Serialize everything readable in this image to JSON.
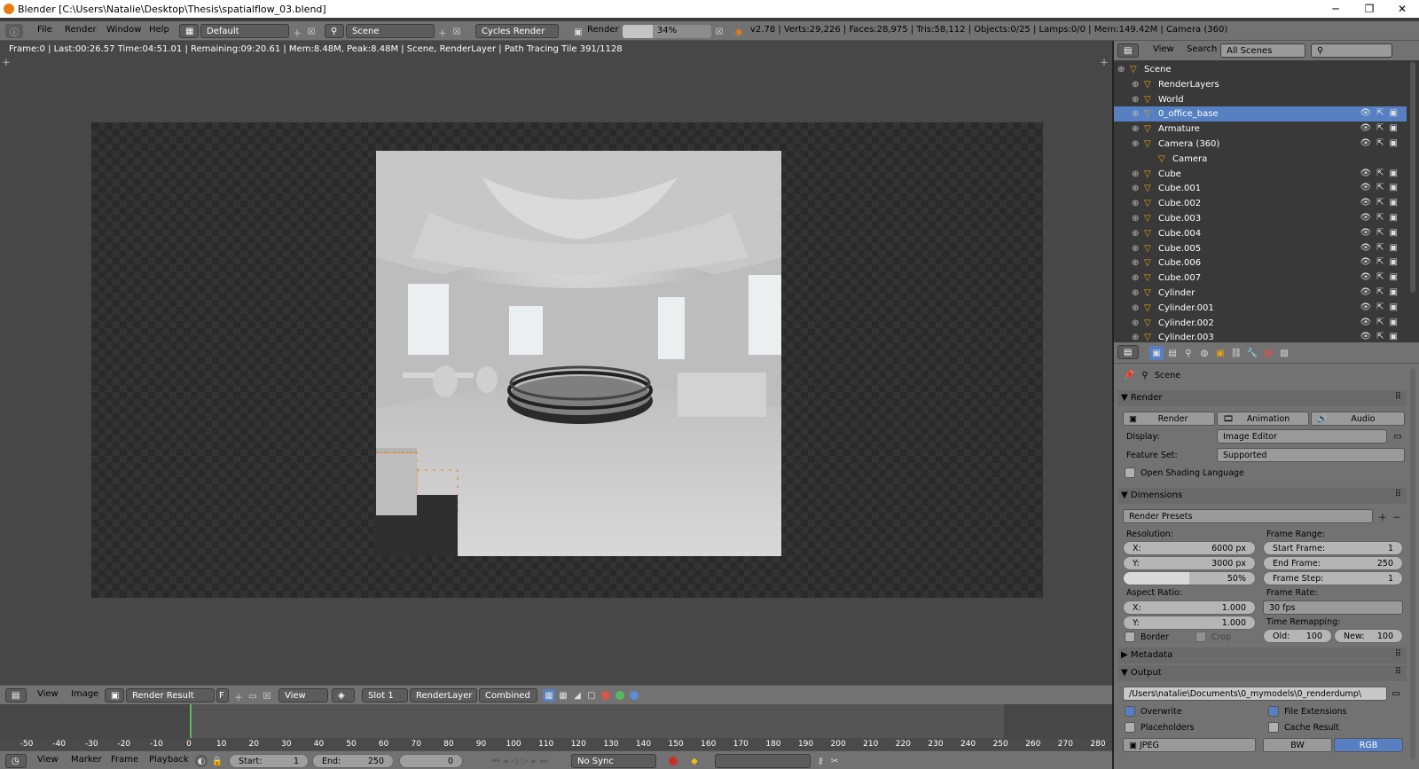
{
  "window": {
    "title": "Blender [C:\\Users\\Natalie\\Desktop\\Thesis\\spatialflow_03.blend]",
    "minimize": "─",
    "maximize": "❐",
    "close": "✕"
  },
  "menubar": {
    "file": "File",
    "render": "Render",
    "window": "Window",
    "help": "Help",
    "layout": "Default",
    "scene": "Scene",
    "engine": "Cycles Render",
    "render_label": "Render",
    "progress": "34%",
    "progress_fraction": 0.34,
    "stats": "v2.78 | Verts:29,226 | Faces:28,975 | Tris:58,112 | Objects:0/25 | Lamps:0/0 | Mem:149.42M | Camera (360)"
  },
  "viewport": {
    "status": "Frame:0 | Last:00:26.57 Time:04:51.01 | Remaining:09:20.61 | Mem:8.48M, Peak:8.48M | Scene, RenderLayer | Path Tracing Tile 391/1128"
  },
  "image_header": {
    "view": "View",
    "image": "Image",
    "render_result": "Render Result",
    "f": "F",
    "view2": "View",
    "slot": "Slot 1",
    "layer": "RenderLayer",
    "pass": "Combined"
  },
  "timeline": {
    "ticks": [
      "-50",
      "-40",
      "-30",
      "-20",
      "-10",
      "0",
      "10",
      "20",
      "30",
      "40",
      "50",
      "60",
      "70",
      "80",
      "90",
      "100",
      "110",
      "120",
      "130",
      "140",
      "150",
      "160",
      "170",
      "180",
      "190",
      "200",
      "210",
      "220",
      "230",
      "240",
      "250",
      "260",
      "270",
      "280"
    ],
    "view": "View",
    "marker": "Marker",
    "frame": "Frame",
    "playback": "Playback",
    "start_label": "Start:",
    "start": "1",
    "end_label": "End:",
    "end": "250",
    "current": "0",
    "sync": "No Sync"
  },
  "outliner": {
    "view": "View",
    "search": "Search",
    "filter": "All Scenes",
    "items": [
      {
        "name": "Scene",
        "indent": 0
      },
      {
        "name": "RenderLayers",
        "indent": 1
      },
      {
        "name": "World",
        "indent": 1
      },
      {
        "name": "0_office_base",
        "indent": 1,
        "selected": true
      },
      {
        "name": "Armature",
        "indent": 1
      },
      {
        "name": "Camera (360)",
        "indent": 1
      },
      {
        "name": "Camera",
        "indent": 2
      },
      {
        "name": "Cube",
        "indent": 1
      },
      {
        "name": "Cube.001",
        "indent": 1
      },
      {
        "name": "Cube.002",
        "indent": 1
      },
      {
        "name": "Cube.003",
        "indent": 1
      },
      {
        "name": "Cube.004",
        "indent": 1
      },
      {
        "name": "Cube.005",
        "indent": 1
      },
      {
        "name": "Cube.006",
        "indent": 1
      },
      {
        "name": "Cube.007",
        "indent": 1
      },
      {
        "name": "Cylinder",
        "indent": 1
      },
      {
        "name": "Cylinder.001",
        "indent": 1
      },
      {
        "name": "Cylinder.002",
        "indent": 1
      },
      {
        "name": "Cylinder.003",
        "indent": 1
      }
    ]
  },
  "properties": {
    "scene": "Scene",
    "render": {
      "header": "Render",
      "render_btn": "Render",
      "animation_btn": "Animation",
      "audio_btn": "Audio",
      "display_label": "Display:",
      "display": "Image Editor",
      "feature_label": "Feature Set:",
      "feature": "Supported",
      "osl": "Open Shading Language"
    },
    "dimensions": {
      "header": "Dimensions",
      "presets": "Render Presets",
      "resolution": "Resolution:",
      "x_label": "X:",
      "x": "6000 px",
      "y_label": "Y:",
      "y": "3000 px",
      "pct": "50%",
      "frame_range": "Frame Range:",
      "start_label": "Start Frame:",
      "start": "1",
      "end_label": "End Frame:",
      "end": "250",
      "step_label": "Frame Step:",
      "step": "1",
      "aspect": "Aspect Ratio:",
      "ax": "1.000",
      "ay": "1.000",
      "frame_rate": "Frame Rate:",
      "fps": "30 fps",
      "remap": "Time Remapping:",
      "old_label": "Old:",
      "old": "100",
      "new_label": "New:",
      "new": "100",
      "border": "Border",
      "crop": "Crop"
    },
    "metadata": {
      "header": "Metadata"
    },
    "output": {
      "header": "Output",
      "path": "/Users\\natalie\\Documents\\0_mymodels\\0_renderdump\\",
      "overwrite": "Overwrite",
      "file_ext": "File Extensions",
      "placeholders": "Placeholders",
      "cache": "Cache Result",
      "format": "JPEG",
      "bw": "BW",
      "rgb": "RGB"
    }
  },
  "colors": {
    "selection": "#5680c2",
    "accent": "#e87d0d"
  }
}
